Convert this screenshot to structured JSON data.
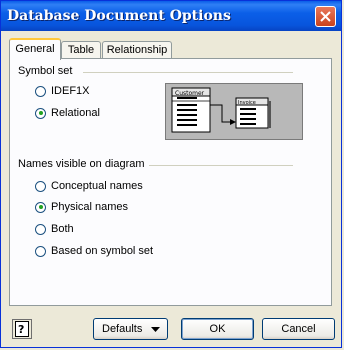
{
  "window": {
    "title": "Database Document Options"
  },
  "tabs": [
    {
      "label": "General",
      "active": true
    },
    {
      "label": "Table",
      "active": false
    },
    {
      "label": "Relationship",
      "active": false
    }
  ],
  "symbol_set": {
    "label": "Symbol set",
    "options": [
      {
        "label": "IDEF1X",
        "checked": false
      },
      {
        "label": "Relational",
        "checked": true
      }
    ],
    "preview": {
      "table1": "Customer",
      "table2": "Invoice"
    }
  },
  "names_visible": {
    "label": "Names visible on diagram",
    "options": [
      {
        "label": "Conceptual names",
        "checked": false
      },
      {
        "label": "Physical names",
        "checked": true
      },
      {
        "label": "Both",
        "checked": false
      },
      {
        "label": "Based on symbol set",
        "checked": false
      }
    ]
  },
  "buttons": {
    "defaults": "Defaults",
    "ok": "OK",
    "cancel": "Cancel"
  },
  "colors": {
    "titlebar": "#0855dd",
    "accent_tab": "#ffc83c",
    "radio_check": "#21a121"
  }
}
